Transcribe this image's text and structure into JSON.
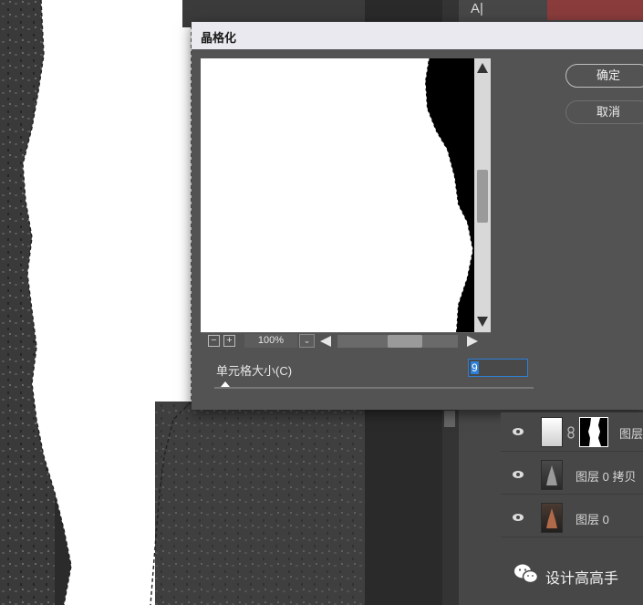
{
  "dialog": {
    "title": "晶格化",
    "ok_label": "确定",
    "cancel_label": "取消",
    "zoom": "100%",
    "cell_size_label": "单元格大小(C)",
    "cell_size_value": "9",
    "cell_size_slider_fraction": 0.02
  },
  "layers": [
    {
      "name": "图层",
      "has_mask": true
    },
    {
      "name": "图层 0 拷贝",
      "has_mask": false
    },
    {
      "name": "图层 0",
      "has_mask": false
    }
  ],
  "watermark": "设计高高手",
  "icons": [
    "eye-icon",
    "link-icon",
    "wechat-icon",
    "chevron-down-icon",
    "arrow-up-icon",
    "arrow-down-icon",
    "arrow-left-icon",
    "arrow-right-icon",
    "zoom-in-icon",
    "zoom-out-icon"
  ],
  "colors": {
    "accent": "#2d7fd8",
    "dialog_bg": "#535353",
    "panel_bg": "#474747"
  }
}
